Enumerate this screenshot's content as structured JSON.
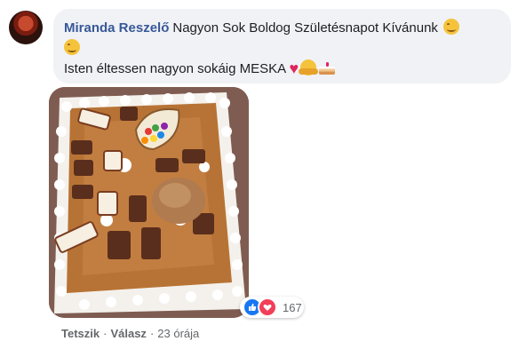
{
  "comment": {
    "author": "Miranda Reszelő",
    "line1": "Nagyon Sok Boldog Születésnapot Kívánunk",
    "line2": "Isten éltessen nagyon sokáig MESKA",
    "emojis": [
      "smiling-face-icon",
      "smiling-face-icon",
      "red-heart-icon",
      "hugging-face-icon",
      "shortcake-icon"
    ]
  },
  "reactions": {
    "types": [
      "like-icon",
      "love-icon"
    ],
    "count": "167"
  },
  "actions": {
    "like": "Tetszik",
    "reply": "Válasz",
    "timestamp": "23 órája",
    "separator": "·"
  },
  "colors": {
    "author": "#385898",
    "bubble": "#f0f2f5",
    "like": "#1877f2",
    "love": "#f33e58",
    "meta": "#65676b"
  }
}
